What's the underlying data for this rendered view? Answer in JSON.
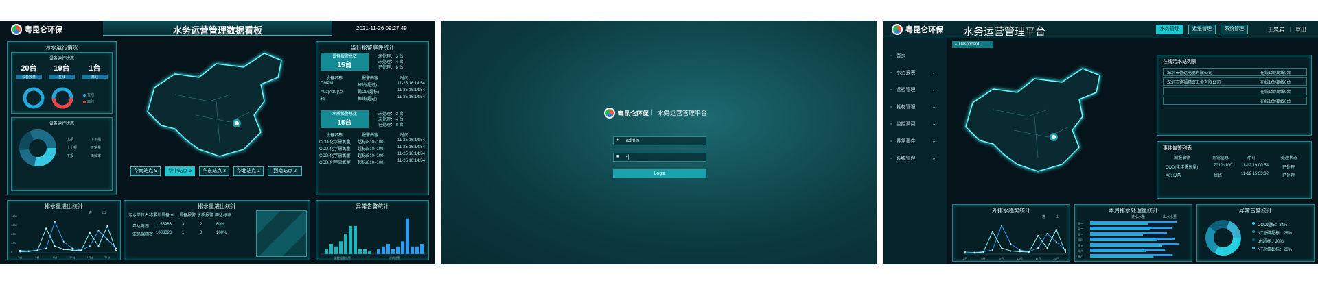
{
  "brand": {
    "name": "粤昆仑环保"
  },
  "dashboard": {
    "title": "水务运营管理数据看板",
    "datetime": "2021-11-26  09:27:49",
    "sewage": {
      "title": "污水运行情况",
      "sub": "设备运行状态",
      "stats": [
        {
          "value": "20台",
          "label": "设备数量"
        },
        {
          "value": "19台",
          "label": "在线"
        },
        {
          "value": "1台",
          "label": "离线"
        }
      ],
      "legend": [
        "在线",
        "离线"
      ],
      "sub2": "设备运行状态",
      "legend2": [
        "上报",
        "下下报",
        "上上报",
        "正常量",
        "下报",
        "无效率"
      ]
    },
    "stations": [
      {
        "label": "华南站点 9"
      },
      {
        "label": "华中站点 5"
      },
      {
        "label": "华东站点 3"
      },
      {
        "label": "华北站点 1"
      },
      {
        "label": "西南站点 2"
      }
    ],
    "events": {
      "title": "当日报警事件统计",
      "box1": {
        "label": "设备报警总数",
        "value": "15台",
        "stats": [
          "未处理： 3 台",
          "未处理： 4 台",
          "已处理： 8 台"
        ]
      },
      "box2": {
        "label": "水质报警总数",
        "value": "15台",
        "stats": [
          "未处理： 3 台",
          "未处理： 4 台",
          "已处理： 8 台"
        ]
      },
      "headers": [
        "设备名称",
        "报警内容",
        "时间"
      ],
      "rows1": [
        [
          "DMPM",
          "掉线(超过)",
          "11-25 16:14:54"
        ],
        [
          "A03(A10)/点",
          "霸OD(超标)",
          "11-25 16:14:54"
        ],
        [
          "箱",
          "掉线(超过)",
          "11-25 16:14:54"
        ]
      ],
      "rows2": [
        [
          "COD(化学需氧量)",
          "超标(810~100)",
          "11-25 16:14:54"
        ],
        [
          "COD(化学需氧量)",
          "超标(810~100)",
          "11-25 16:14:54"
        ],
        [
          "COD(化学需氧量)",
          "超标(810~100)",
          "11-25 16:14:54"
        ],
        [
          "COD(化学需氧量)",
          "超标(810~100)",
          "11-25 16:14:54"
        ]
      ]
    },
    "drain": {
      "title": "排水量进出统计",
      "legend": [
        "进",
        "出"
      ]
    },
    "drain2": {
      "title": "排水量进出统计",
      "headers": [
        "污水单位名称",
        "累计设备m³",
        "设备报警",
        "水质报警",
        "两达标率"
      ],
      "rows": [
        [
          "粤达电器",
          "1155963",
          "3",
          "2",
          "60%"
        ],
        [
          "亚码瑞精密",
          "1003320",
          "1",
          "0",
          "100%"
        ]
      ]
    },
    "abnormal": {
      "title": "异常告警统计"
    }
  },
  "login": {
    "divider": "|",
    "title": "水务运营管理平台",
    "username": "admin",
    "password": "•|",
    "button": "Login"
  },
  "platform": {
    "title": "水务运营管理平台",
    "nav": [
      {
        "label": "水务管理"
      },
      {
        "label": "运维管理"
      },
      {
        "label": "系统管理"
      }
    ],
    "user": "王忠岩",
    "logout": "登出",
    "tab": "Dashboard",
    "menu": [
      {
        "label": "首页"
      },
      {
        "label": "水务报表"
      },
      {
        "label": "运检管理"
      },
      {
        "label": "耗材管理"
      },
      {
        "label": "监控调阅"
      },
      {
        "label": "异常事件"
      },
      {
        "label": "系统管理"
      }
    ],
    "stations": {
      "title": "在线污水站列表",
      "rows": [
        [
          "深圳市德达电器有限公司",
          "在线1台/离线0台"
        ],
        [
          "深圳市德福精密五金有限公司",
          "在线1台/离线0台"
        ],
        [
          "",
          "在线1台/离线0台"
        ],
        [
          "",
          "在线1台/离线0台"
        ]
      ]
    },
    "alerts": {
      "title": "事件告警列表",
      "headers": [
        "测报事件",
        "异常信息",
        "时间",
        "处理状态"
      ],
      "rows": [
        [
          "COD(化学需氧量)",
          "7010~100",
          "11-12 19:00:54",
          "已处理"
        ],
        [
          "A01设备",
          "掉线",
          "11-12 15:33:32",
          "已处理"
        ]
      ]
    },
    "outflow": {
      "title": "外排水趋势统计",
      "legend": [
        "进",
        "出"
      ]
    },
    "weekly": {
      "title": "本周排水处理量统计",
      "legend": [
        "进水水量",
        "出水水量"
      ]
    },
    "alarms": {
      "title": "异常告警统计",
      "legend": [
        {
          "label": "COD超标：34%"
        },
        {
          "label": "NT总磷超标：28%"
        },
        {
          "label": "pH超标：20%"
        },
        {
          "label": "NT总氮超标：20%"
        }
      ]
    }
  },
  "chart_data": [
    {
      "type": "line",
      "title": "排水量进出统计",
      "x": [
        "1日",
        "3日",
        "5日",
        "7日",
        "9日",
        "11日",
        "13日",
        "15日",
        "17日",
        "19日",
        "21日",
        "23日"
      ],
      "series": [
        {
          "name": "进",
          "values": [
            100,
            80,
            120,
            200,
            1400,
            500,
            200,
            120,
            300,
            1000,
            600,
            200
          ]
        },
        {
          "name": "出",
          "values": [
            50,
            60,
            100,
            1100,
            300,
            150,
            120,
            100,
            900,
            300,
            1200,
            100
          ]
        }
      ],
      "yticks": [
        "0",
        "200",
        "400",
        "600",
        "800",
        "1000",
        "1200",
        "1400",
        "1600"
      ]
    },
    {
      "type": "bar",
      "title": "异常告警统计",
      "categories": [
        "监控设备告警",
        "水质告警"
      ],
      "series": [
        {
          "name": "监控设备告警",
          "values": [
            2,
            4,
            3,
            5,
            8,
            11,
            11,
            2,
            2,
            1
          ]
        },
        {
          "name": "水质告警",
          "values": [
            2,
            3,
            4,
            2,
            3,
            5,
            14,
            3,
            3,
            4
          ]
        }
      ]
    },
    {
      "type": "line",
      "title": "外排水趋势统计",
      "x": [
        "1日",
        "3日",
        "5日",
        "7日",
        "9日",
        "11日",
        "13日",
        "15日",
        "17日",
        "19日",
        "21日",
        "23日"
      ],
      "series": [
        {
          "name": "进",
          "values": [
            100,
            80,
            120,
            200,
            1400,
            500,
            200,
            120,
            300,
            1000,
            600,
            200
          ]
        },
        {
          "name": "出",
          "values": [
            50,
            60,
            100,
            1100,
            300,
            150,
            120,
            100,
            900,
            300,
            1200,
            100
          ]
        }
      ]
    },
    {
      "type": "bar",
      "title": "本周排水处理量统计",
      "categories": [
        "周一",
        "周二",
        "周三",
        "周四",
        "周五",
        "周六",
        "周日"
      ],
      "series": [
        {
          "name": "进水水量",
          "values": [
            90,
            85,
            80,
            88,
            92,
            78,
            86
          ]
        },
        {
          "name": "出水水量",
          "values": [
            60,
            62,
            55,
            70,
            75,
            58,
            66
          ]
        }
      ]
    },
    {
      "type": "pie",
      "title": "异常告警统计",
      "labels": [
        "COD超标",
        "NT总磷超标",
        "pH超标",
        "NT总氮超标"
      ],
      "values": [
        34,
        28,
        20,
        20
      ]
    }
  ],
  "colors": {
    "accent": "#1fc7d0",
    "bg": "#05141a",
    "bar": "#1a8fe0"
  }
}
